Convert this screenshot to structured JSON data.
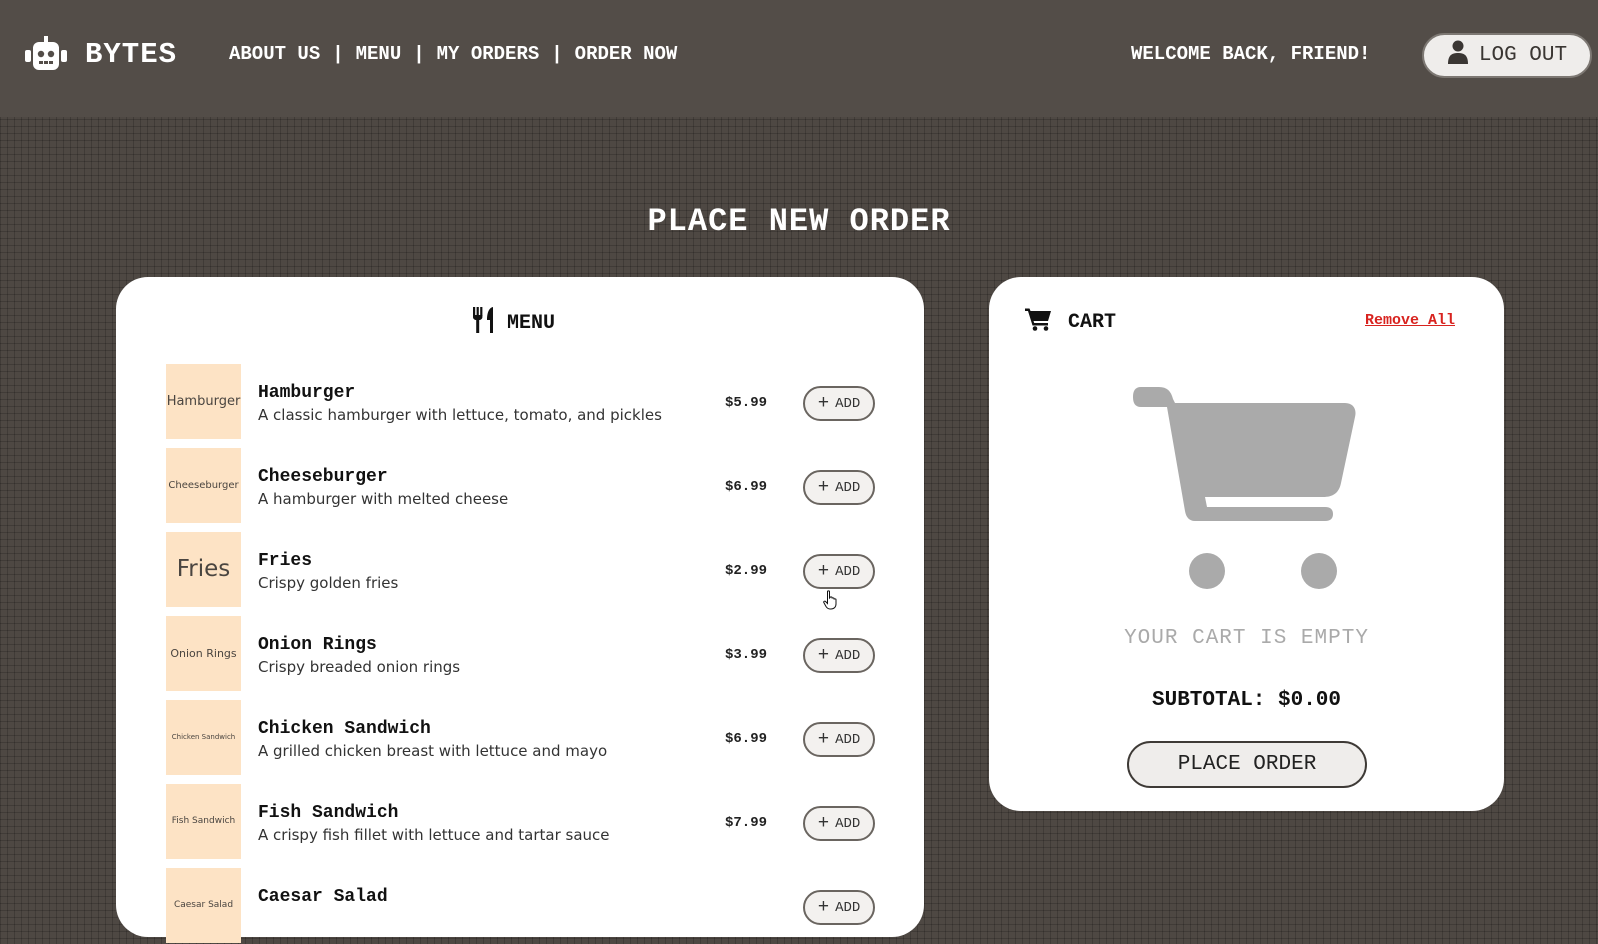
{
  "header": {
    "brand": "BYTES",
    "nav": [
      "ABOUT US",
      "MENU",
      "MY ORDERS",
      "ORDER NOW"
    ],
    "nav_separator": "|",
    "welcome": "WELCOME BACK, FRIEND!",
    "logout_label": "LOG OUT",
    "logo_icon": "robot-icon",
    "logout_icon": "user-icon"
  },
  "page": {
    "title": "PLACE NEW ORDER"
  },
  "menu": {
    "heading": "MENU",
    "heading_icon": "utensils-icon",
    "add_label": "ADD",
    "add_symbol": "+",
    "items": [
      {
        "thumb": "Hamburger",
        "name": "Hamburger",
        "desc": "A classic hamburger with lettuce, tomato, and pickles",
        "price": "$5.99"
      },
      {
        "thumb": "Cheeseburger",
        "name": "Cheeseburger",
        "desc": "A hamburger with melted cheese",
        "price": "$6.99"
      },
      {
        "thumb": "Fries",
        "name": "Fries",
        "desc": "Crispy golden fries",
        "price": "$2.99"
      },
      {
        "thumb": "Onion Rings",
        "name": "Onion Rings",
        "desc": "Crispy breaded onion rings",
        "price": "$3.99"
      },
      {
        "thumb": "Chicken Sandwich",
        "name": "Chicken Sandwich",
        "desc": "A grilled chicken breast with lettuce and mayo",
        "price": "$6.99"
      },
      {
        "thumb": "Fish Sandwich",
        "name": "Fish Sandwich",
        "desc": "A crispy fish fillet with lettuce and tartar sauce",
        "price": "$7.99"
      },
      {
        "thumb": "Caesar Salad",
        "name": "Caesar Salad",
        "desc": "",
        "price": ""
      }
    ]
  },
  "cart": {
    "heading": "CART",
    "heading_icon": "shopping-cart-icon",
    "remove_all": "Remove All",
    "empty_icon": "empty-cart-icon",
    "empty_text": "YOUR CART IS EMPTY",
    "subtotal": "SUBTOTAL: $0.00",
    "place_order": "PLACE ORDER"
  },
  "colors": {
    "background": "#4e4843",
    "header": "#534d48",
    "thumbnail": "#fde3c5",
    "remove_link": "#d8231f",
    "empty_cart_gray": "#aaaaaa"
  }
}
